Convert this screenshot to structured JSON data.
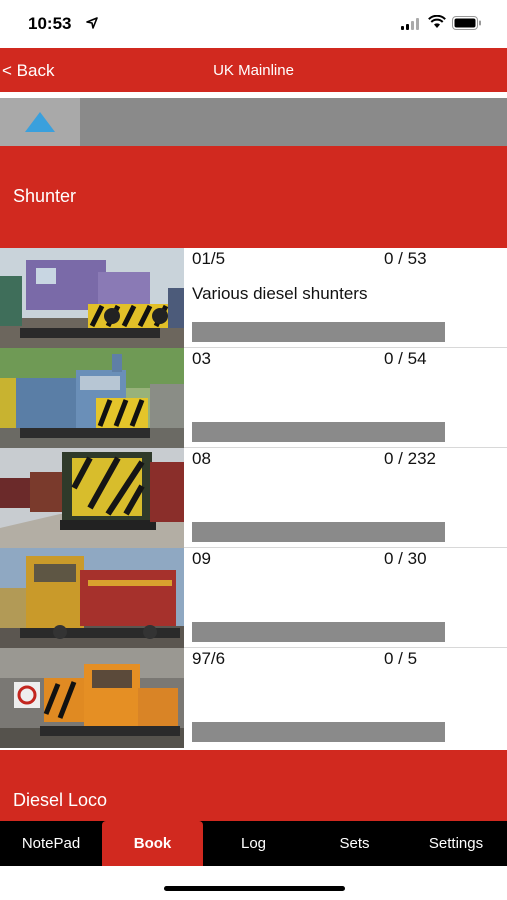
{
  "status": {
    "time": "10:53"
  },
  "nav": {
    "back_label": "< Back",
    "title": "UK Mainline"
  },
  "sections": [
    {
      "title": "Shunter"
    },
    {
      "title": "Diesel Loco"
    }
  ],
  "rows": [
    {
      "class": "01/5",
      "count": "0 / 53",
      "desc": "Various diesel shunters",
      "progress": 0
    },
    {
      "class": "03",
      "count": "0 / 54",
      "desc": "",
      "progress": 0
    },
    {
      "class": "08",
      "count": "0 / 232",
      "desc": "",
      "progress": 0
    },
    {
      "class": "09",
      "count": "0 / 30",
      "desc": "",
      "progress": 0
    },
    {
      "class": "97/6",
      "count": "0 / 5",
      "desc": "",
      "progress": 0
    }
  ],
  "tabs": [
    {
      "label": "NotePad"
    },
    {
      "label": "Book"
    },
    {
      "label": "Log"
    },
    {
      "label": "Sets"
    },
    {
      "label": "Settings"
    }
  ],
  "active_tab": "Book",
  "colors": {
    "accent": "#d1291f",
    "bar_gray": "#8a8a8a",
    "tab_bar": "#000000"
  }
}
